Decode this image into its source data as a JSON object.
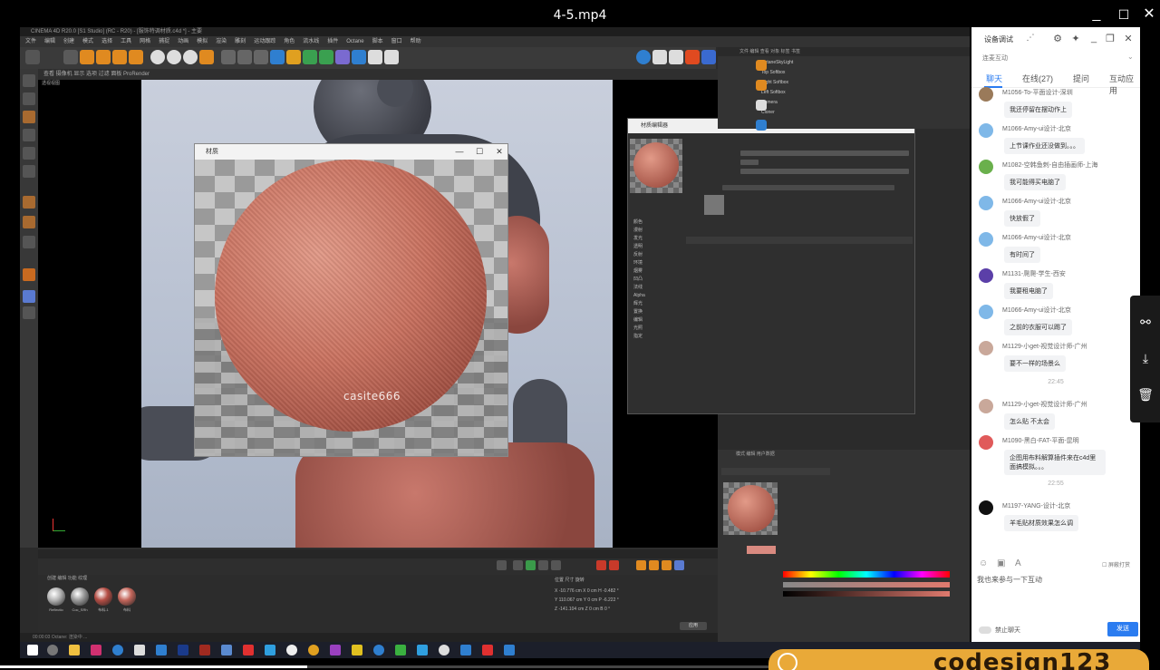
{
  "player": {
    "title": "4-5.mp4",
    "minimize": "_",
    "maximize": "☐",
    "close": "✕",
    "progress_fraction": 0.4
  },
  "c4d": {
    "titlebar": "CINEMA 4D R20.0 [S1 Studio] (RC - R20) - [服饰特调材质.c4d *] - 主要",
    "menus": [
      "文件",
      "编辑",
      "创建",
      "模式",
      "选择",
      "工具",
      "网格",
      "捕捉",
      "动画",
      "模拟",
      "渲染",
      "雕刻",
      "运动跟踪",
      "角色",
      "流水线",
      "插件",
      "Octane",
      "脚本",
      "窗口",
      "帮助"
    ],
    "viewport_menu": "查看  摄像机  显示  选项  过滤  面板  ProRender",
    "viewport_label": "透视视图",
    "status": "00:00:03   Octane: 渲染中 ..."
  },
  "material_window": {
    "title": "材质",
    "minimize": "—",
    "maximize": "☐",
    "close": "✕",
    "watermark": "casite666"
  },
  "material_editor": {
    "title": "材质编辑器",
    "channels": [
      "颜色",
      "漫射",
      "发光",
      "透明",
      "反射",
      "环境",
      "烟雾",
      "凹凸",
      "法线",
      "Alpha",
      "辉光",
      "置换",
      "编辑",
      "光照",
      "指定"
    ]
  },
  "object_manager": {
    "header": "文件  编辑  查看  对象  标签  书签",
    "objects": [
      "OctaneSkyLight",
      "Top Softbox",
      "Right Softbox",
      "Left Softbox",
      "Camera",
      "Cloner"
    ]
  },
  "attribute_manager": {
    "header": "模式  编辑  用户数据"
  },
  "material_manager": {
    "header": "创建  编辑  功能  纹理",
    "materials": [
      {
        "label": "Reflectio",
        "color": "#b5b5b5"
      },
      {
        "label": "Coc_SRh",
        "color": "#9b9b9b"
      },
      {
        "label": "布料-1",
        "color": "#b54e45"
      },
      {
        "label": "布料",
        "color": "#c4665b"
      }
    ]
  },
  "coordinates": {
    "header": "位置        尺寸        旋转",
    "rows": [
      "X  -10.776 cm    X  0 cm    H  -0.482 °",
      "Y  110.067 cm    Y  0 cm    P  -6.222 °",
      "Z  -141.104 cm   Z  0 cm    B  0 °"
    ],
    "apply": "应用"
  },
  "chat": {
    "device_label": "设备调试",
    "connect_label": "连麦互动",
    "tabs": [
      "聊天",
      "在线(27)",
      "提问",
      "互动应用"
    ],
    "messages": [
      {
        "name": "M1056-To-平面设计-深圳",
        "text": "我还停留在摆动作上",
        "avatar": "#9a7a5a"
      },
      {
        "name": "M1066-Amy-ui设计-北京",
        "text": "上节课作业还没做到。。。",
        "avatar": "#7fb8e8"
      },
      {
        "name": "M1082-空韩鱼刺-自由插画师-上海",
        "text": "我可能得买电脑了",
        "avatar": "#6ab04c"
      },
      {
        "name": "M1066-Amy-ui设计-北京",
        "text": "快放假了",
        "avatar": "#7fb8e8"
      },
      {
        "name": "M1066-Amy-ui设计-北京",
        "text": "有时间了",
        "avatar": "#7fb8e8"
      },
      {
        "name": "M1131-爬爬-学生-西安",
        "text": "我要租电脑了",
        "avatar": "#5b3fa8"
      },
      {
        "name": "M1066-Amy-ui设计-北京",
        "text": "之前的衣服可以踢了",
        "avatar": "#7fb8e8"
      },
      {
        "name": "M1129-小get-视觉设计师-广州",
        "text": "要不一样的场景么",
        "avatar": "#c9a89a"
      }
    ],
    "time_1": "22:45",
    "messages_2": [
      {
        "name": "M1129-小get-视觉设计师-广州",
        "text": "怎么贴 不太会",
        "avatar": "#c9a89a"
      },
      {
        "name": "M1090-黑白-FAT-平面-昆明",
        "text": "企图用布料解算插件来在c4d里面搞模拟。。。",
        "avatar": "#e05a5a"
      }
    ],
    "time_2": "22:55",
    "messages_3": [
      {
        "name": "M1197-YANG-设计-北京",
        "text": "羊毛贴材质效果怎么调",
        "avatar": "#111111"
      }
    ],
    "input_placeholder": "我也来参与一下互动",
    "mute_label": "禁止聊天",
    "send_label": "发送",
    "screenshot_label": "屏蔽打赏"
  },
  "side_tools": [
    "share-icon",
    "download-icon",
    "trash-icon"
  ],
  "promo": {
    "text": "codesign123"
  }
}
